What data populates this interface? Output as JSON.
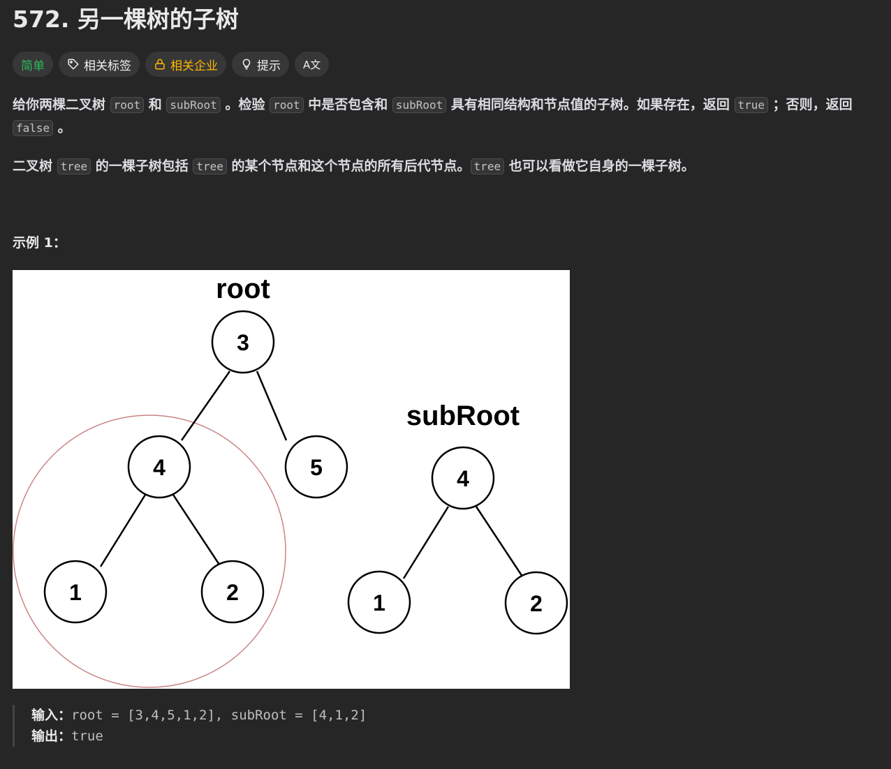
{
  "problem": {
    "title": "572. 另一棵树的子树",
    "difficulty": "简单",
    "tags": {
      "related_tags": "相关标签",
      "related_companies": "相关企业",
      "hint": "提示",
      "translate": "A文"
    },
    "accent_colors": {
      "easy": "#2cbb5d",
      "company": "#ffb800"
    }
  },
  "description": {
    "p1": {
      "t1": "给你两棵二叉树 ",
      "c1": "root",
      "t2": " 和 ",
      "c2": "subRoot",
      "t3": " 。检验 ",
      "c3": "root",
      "t4": " 中是否包含和 ",
      "c4": "subRoot",
      "t5": " 具有相同结构和节点值的子树。如果存在，返回 ",
      "c5": "true",
      "t6": " ；否则，返回 ",
      "c6": "false",
      "t7": " 。"
    },
    "p2": {
      "t1": "二叉树 ",
      "c1": "tree",
      "t2": " 的一棵子树包括 ",
      "c2": "tree",
      "t3": " 的某个节点和这个节点的所有后代节点。",
      "c3": "tree",
      "t4": " 也可以看做它自身的一棵子树。"
    }
  },
  "example": {
    "title": "示例 1：",
    "figure": {
      "root_label": "root",
      "subroot_label": "subRoot",
      "root_tree": [
        "3",
        "4",
        "5",
        "1",
        "2"
      ],
      "subroot_tree": [
        "4",
        "1",
        "2"
      ]
    },
    "input_label": "输入：",
    "input_value": "root = [3,4,5,1,2], subRoot = [4,1,2]",
    "output_label": "输出：",
    "output_value": "true"
  }
}
